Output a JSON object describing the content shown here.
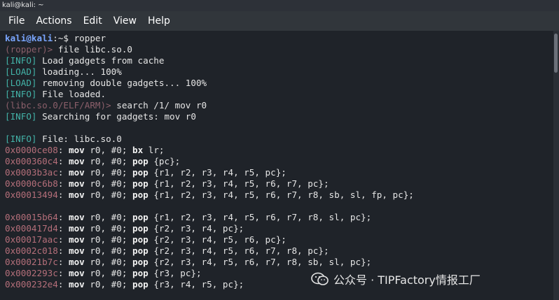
{
  "window": {
    "title": "kali@kali: ~"
  },
  "menu": [
    "File",
    "Actions",
    "Edit",
    "View",
    "Help"
  ],
  "terminal": [
    [
      [
        "user",
        "kali@kali"
      ],
      [
        "sep",
        ":~$ "
      ],
      [
        "txt",
        "ropper"
      ]
    ],
    [
      [
        "dim",
        "(ropper)> "
      ],
      [
        "txt",
        "file libc.so.0"
      ]
    ],
    [
      [
        "tag",
        "[INFO]"
      ],
      [
        "txt",
        " Load gadgets from cache"
      ]
    ],
    [
      [
        "tag",
        "[LOAD]"
      ],
      [
        "txt",
        " loading... 100%"
      ]
    ],
    [
      [
        "tag",
        "[LOAD]"
      ],
      [
        "txt",
        " removing double gadgets... 100%"
      ]
    ],
    [
      [
        "tag",
        "[INFO]"
      ],
      [
        "txt",
        " File loaded."
      ]
    ],
    [
      [
        "dim",
        "(libc.so.0/ELF/ARM)> "
      ],
      [
        "txt",
        "search /1/ mov r0"
      ]
    ],
    [
      [
        "tag",
        "[INFO]"
      ],
      [
        "txt",
        " Searching for gadgets: mov r0"
      ]
    ],
    [],
    [
      [
        "tag",
        "[INFO]"
      ],
      [
        "txt",
        " File: libc.so.0"
      ]
    ],
    [
      [
        "addr",
        "0x0000ce08"
      ],
      [
        "txt",
        ": "
      ],
      [
        "kw",
        "mov"
      ],
      [
        "txt",
        " r0, #0; "
      ],
      [
        "kw",
        "bx"
      ],
      [
        "txt",
        " lr;"
      ]
    ],
    [
      [
        "addr",
        "0x000360c4"
      ],
      [
        "txt",
        ": "
      ],
      [
        "kw",
        "mov"
      ],
      [
        "txt",
        " r0, #0; "
      ],
      [
        "kw",
        "pop"
      ],
      [
        "txt",
        " {pc};"
      ]
    ],
    [
      [
        "addr",
        "0x0003b3ac"
      ],
      [
        "txt",
        ": "
      ],
      [
        "kw",
        "mov"
      ],
      [
        "txt",
        " r0, #0; "
      ],
      [
        "kw",
        "pop"
      ],
      [
        "txt",
        " {r1, r2, r3, r4, r5, pc};"
      ]
    ],
    [
      [
        "addr",
        "0x0000c6b8"
      ],
      [
        "txt",
        ": "
      ],
      [
        "kw",
        "mov"
      ],
      [
        "txt",
        " r0, #0; "
      ],
      [
        "kw",
        "pop"
      ],
      [
        "txt",
        " {r1, r2, r3, r4, r5, r6, r7, pc};"
      ]
    ],
    [
      [
        "addr",
        "0x00013494"
      ],
      [
        "txt",
        ": "
      ],
      [
        "kw",
        "mov"
      ],
      [
        "txt",
        " r0, #0; "
      ],
      [
        "kw",
        "pop"
      ],
      [
        "txt",
        " {r1, r2, r3, r4, r5, r6, r7, r8, sb, sl, fp, pc};"
      ]
    ],
    [],
    [
      [
        "addr",
        "0x00015b64"
      ],
      [
        "txt",
        ": "
      ],
      [
        "kw",
        "mov"
      ],
      [
        "txt",
        " r0, #0; "
      ],
      [
        "kw",
        "pop"
      ],
      [
        "txt",
        " {r1, r2, r3, r4, r5, r6, r7, r8, sl, pc};"
      ]
    ],
    [
      [
        "addr",
        "0x000417d4"
      ],
      [
        "txt",
        ": "
      ],
      [
        "kw",
        "mov"
      ],
      [
        "txt",
        " r0, #0; "
      ],
      [
        "kw",
        "pop"
      ],
      [
        "txt",
        " {r2, r3, r4, pc};"
      ]
    ],
    [
      [
        "addr",
        "0x00017aac"
      ],
      [
        "txt",
        ": "
      ],
      [
        "kw",
        "mov"
      ],
      [
        "txt",
        " r0, #0; "
      ],
      [
        "kw",
        "pop"
      ],
      [
        "txt",
        " {r2, r3, r4, r5, r6, pc};"
      ]
    ],
    [
      [
        "addr",
        "0x0002c018"
      ],
      [
        "txt",
        ": "
      ],
      [
        "kw",
        "mov"
      ],
      [
        "txt",
        " r0, #0; "
      ],
      [
        "kw",
        "pop"
      ],
      [
        "txt",
        " {r2, r3, r4, r5, r6, r7, r8, pc};"
      ]
    ],
    [
      [
        "addr",
        "0x00021b7c"
      ],
      [
        "txt",
        ": "
      ],
      [
        "kw",
        "mov"
      ],
      [
        "txt",
        " r0, #0; "
      ],
      [
        "kw",
        "pop"
      ],
      [
        "txt",
        " {r2, r3, r4, r5, r6, r7, r8, sb, sl, pc};"
      ]
    ],
    [
      [
        "addr",
        "0x0002293c"
      ],
      [
        "txt",
        ": "
      ],
      [
        "kw",
        "mov"
      ],
      [
        "txt",
        " r0, #0; "
      ],
      [
        "kw",
        "pop"
      ],
      [
        "txt",
        " {r3, pc};"
      ]
    ],
    [
      [
        "addr",
        "0x000232e4"
      ],
      [
        "txt",
        ": "
      ],
      [
        "kw",
        "mov"
      ],
      [
        "txt",
        " r0, #0; "
      ],
      [
        "kw",
        "pop"
      ],
      [
        "txt",
        " {r3, r4, r5, pc};"
      ]
    ]
  ],
  "watermark": {
    "text": "公众号 · TIPFactory情报工厂",
    "icon": "wechat-icon"
  }
}
